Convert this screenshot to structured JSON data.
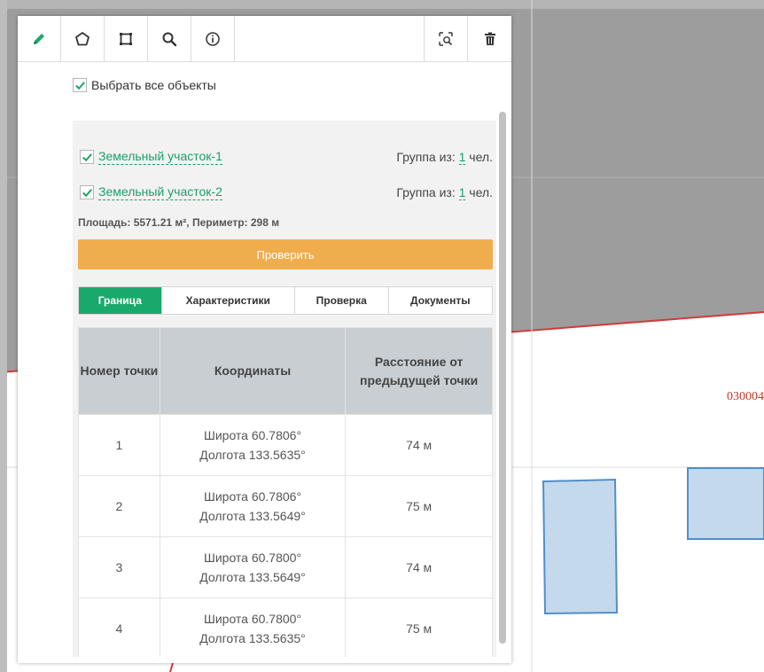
{
  "map": {
    "parcel_label": "030004",
    "colors": {
      "fill": "#c5d9ec",
      "stroke": "#4f8fc9",
      "boundary": "#d23b3b",
      "grey_area": "#9d9d9d"
    }
  },
  "toolbar": {
    "icons": [
      "pencil-icon",
      "polygon-icon",
      "rectangle-icon",
      "search-icon",
      "info-icon",
      "zoom-to-extent-icon",
      "trash-icon"
    ],
    "active_color": "#1aa96c"
  },
  "select_all": {
    "label": "Выбрать все объекты",
    "checked": true
  },
  "objects": [
    {
      "name": "Земельный участок-1",
      "group_prefix": "Группа из: ",
      "group_count": "1",
      "group_suffix": " чел.",
      "checked": true
    },
    {
      "name": "Земельный участок-2",
      "group_prefix": "Группа из: ",
      "group_count": "1",
      "group_suffix": " чел.",
      "checked": true
    }
  ],
  "summary": "Площадь: 5571.21 м², Периметр: 298 м",
  "check_button": {
    "label": "Проверить",
    "color": "#f0ad4e"
  },
  "tabs": [
    {
      "label": "Граница",
      "active": true
    },
    {
      "label": "Характеристики",
      "active": false
    },
    {
      "label": "Проверка",
      "active": false
    },
    {
      "label": "Документы",
      "active": false
    }
  ],
  "table": {
    "headers": [
      "Номер точки",
      "Координаты",
      "Расстояние от предыдущей точки"
    ],
    "rows": [
      {
        "num": "1",
        "lat": "Широта 60.7806°",
        "lon": "Долгота 133.5635°",
        "dist": "74 м"
      },
      {
        "num": "2",
        "lat": "Широта 60.7806°",
        "lon": "Долгота 133.5649°",
        "dist": "75 м"
      },
      {
        "num": "3",
        "lat": "Широта 60.7800°",
        "lon": "Долгота 133.5649°",
        "dist": "74 м"
      },
      {
        "num": "4",
        "lat": "Широта 60.7800°",
        "lon": "Долгота 133.5635°",
        "dist": "75 м"
      }
    ]
  }
}
